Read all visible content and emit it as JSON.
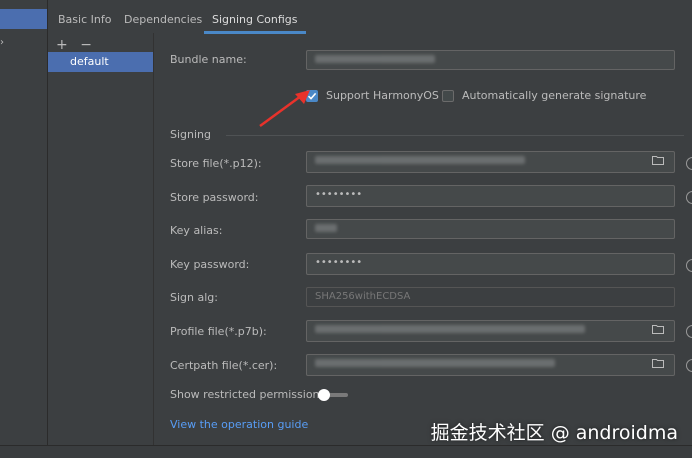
{
  "tabs": [
    {
      "label": "Basic Info"
    },
    {
      "label": "Dependencies"
    },
    {
      "label": "Signing Configs"
    }
  ],
  "config_list": {
    "add": "+",
    "remove": "−",
    "items": [
      {
        "label": "default"
      }
    ]
  },
  "form": {
    "bundle_name": {
      "label": "Bundle name:",
      "value": ""
    },
    "support_harmonyos": {
      "label": "Support HarmonyOS",
      "checked": true
    },
    "auto_signature": {
      "label": "Automatically generate signature",
      "checked": false
    },
    "section_title": "Signing",
    "store_file": {
      "label": "Store file(*.p12):",
      "value": ""
    },
    "store_password": {
      "label": "Store password:",
      "value": "••••••••"
    },
    "key_alias": {
      "label": "Key alias:",
      "value": ""
    },
    "key_password": {
      "label": "Key password:",
      "value": "••••••••"
    },
    "sign_alg": {
      "label": "Sign alg:",
      "value": "SHA256withECDSA"
    },
    "profile_file": {
      "label": "Profile file(*.p7b):",
      "value": ""
    },
    "certpath_file": {
      "label": "Certpath file(*.cer):",
      "value": ""
    },
    "show_restricted": {
      "label": "Show restricted permissions",
      "enabled": false
    },
    "guide_link": "View the operation guide"
  },
  "watermark": "掘金技术社区 @ androidma",
  "colors": {
    "accent": "#4a88c7",
    "selection": "#4b6eaf",
    "link": "#589df6",
    "arrow": "#e8322b"
  }
}
